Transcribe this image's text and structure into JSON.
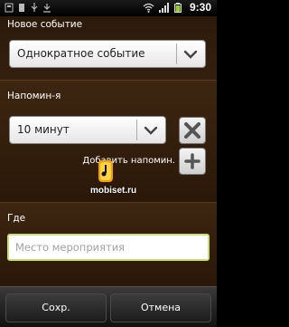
{
  "status_bar": {
    "time": "9:30",
    "icons": [
      "usb-debug-icon",
      "sd-card-icon",
      "usb-icon",
      "download-icon",
      "wifi-icon",
      "signal-icon",
      "battery-icon"
    ]
  },
  "header": {
    "title": "Новое событие"
  },
  "repeat": {
    "selected": "Однократное событие"
  },
  "reminders": {
    "label": "Напомин-я",
    "selected": "10 минут",
    "add_label": "Добавить напомин."
  },
  "location": {
    "label": "Где",
    "placeholder": "Место мероприятия",
    "value": ""
  },
  "watermark": {
    "text": "mobiset.ru"
  },
  "actions": {
    "save_label": "Сохр.",
    "cancel_label": "Отмена"
  },
  "colors": {
    "accent_border": "#c9e07a",
    "background": "#2b1a0b"
  }
}
